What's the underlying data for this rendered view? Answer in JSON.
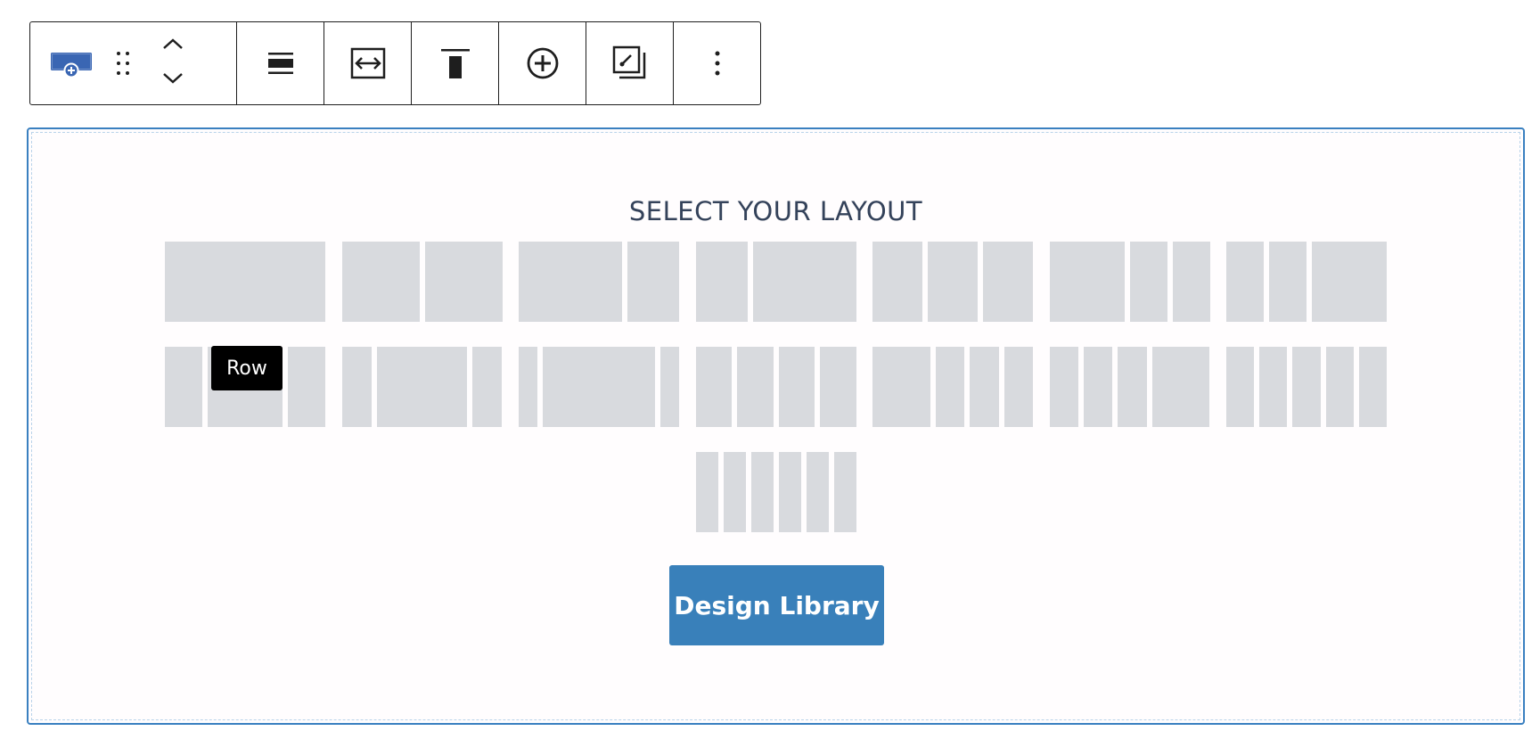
{
  "toolbar": {
    "items": [
      {
        "icon": "row-block-icon",
        "accent": "#3a66b3"
      },
      {
        "icon": "drag-handle-icon"
      },
      {
        "icon": "move-up-icon"
      },
      {
        "icon": "move-down-icon"
      },
      {
        "icon": "align-icon"
      },
      {
        "icon": "full-width-icon"
      },
      {
        "icon": "vertical-align-top-icon"
      },
      {
        "icon": "add-circle-icon"
      },
      {
        "icon": "copy-style-icon"
      },
      {
        "icon": "more-options-icon"
      }
    ]
  },
  "layout_picker": {
    "title": "SELECT YOUR LAYOUT",
    "tooltip": "Row",
    "design_library_label": "Design Library",
    "layouts": [
      {
        "name": "1 column",
        "columns": [
          1
        ]
      },
      {
        "name": "2 columns equal",
        "columns": [
          1,
          1
        ]
      },
      {
        "name": "2 columns 2/3 1/3",
        "columns": [
          2,
          1
        ]
      },
      {
        "name": "2 columns 1/3 2/3",
        "columns": [
          1,
          2
        ]
      },
      {
        "name": "3 columns equal",
        "columns": [
          1,
          1,
          1
        ]
      },
      {
        "name": "3 columns 1/2 1/4 1/4",
        "columns": [
          2,
          1,
          1
        ]
      },
      {
        "name": "3 columns 1/4 1/4 1/2",
        "columns": [
          1,
          1,
          2
        ]
      },
      {
        "name": "3 columns 1/4 1/2 1/4",
        "columns": [
          1,
          2,
          1
        ]
      },
      {
        "name": "3 columns 1/5 3/5 1/5",
        "columns": [
          1,
          3,
          1
        ]
      },
      {
        "name": "3 columns 1/8 6/8 1/8",
        "columns": [
          1,
          6,
          1
        ]
      },
      {
        "name": "4 columns equal",
        "columns": [
          1,
          1,
          1,
          1
        ]
      },
      {
        "name": "4 columns 2/5 1/5 1/5 1/5",
        "columns": [
          2,
          1,
          1,
          1
        ]
      },
      {
        "name": "4 columns 1/5 1/5 1/5 2/5",
        "columns": [
          1,
          1,
          1,
          2
        ]
      },
      {
        "name": "5 columns equal",
        "columns": [
          1,
          1,
          1,
          1,
          1
        ]
      },
      {
        "name": "6 columns equal",
        "columns": [
          1,
          1,
          1,
          1,
          1,
          1
        ]
      }
    ],
    "colors": {
      "tile": "#d8dade",
      "border": "#3a80c0",
      "button": "#3980ba",
      "title": "#34425a"
    }
  }
}
